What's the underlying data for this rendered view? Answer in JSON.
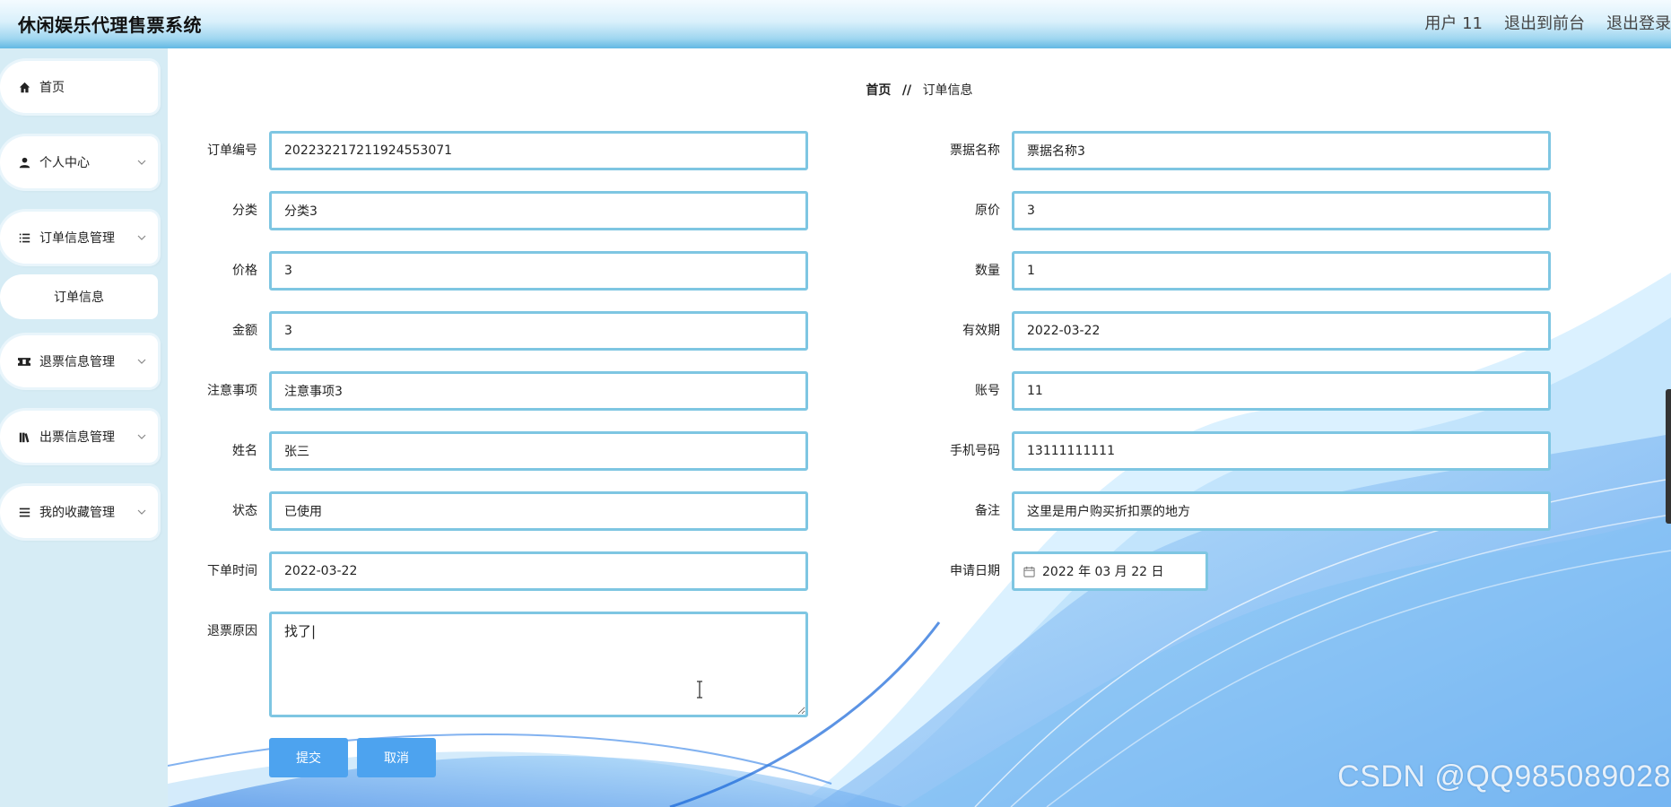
{
  "header": {
    "title": "休闲娱乐代理售票系统",
    "user": "用户 11",
    "to_front": "退出到前台",
    "logout": "退出登录"
  },
  "sidebar": {
    "items": [
      {
        "label": "首页",
        "icon": "home-icon"
      },
      {
        "label": "个人中心",
        "icon": "user-icon"
      },
      {
        "label": "订单信息管理",
        "icon": "list-icon"
      },
      {
        "label": "订单信息",
        "icon": ""
      },
      {
        "label": "退票信息管理",
        "icon": "ticket-icon"
      },
      {
        "label": "出票信息管理",
        "icon": "books-icon"
      },
      {
        "label": "我的收藏管理",
        "icon": "menu-icon"
      }
    ]
  },
  "breadcrumb": {
    "home": "首页",
    "separator": "//",
    "current": "订单信息"
  },
  "form": {
    "order_no": {
      "label": "订单编号",
      "value": "202232217211924553071"
    },
    "ticket_name": {
      "label": "票据名称",
      "value": "票据名称3"
    },
    "category": {
      "label": "分类",
      "value": "分类3"
    },
    "original_price": {
      "label": "原价",
      "value": "3"
    },
    "price": {
      "label": "价格",
      "value": "3"
    },
    "quantity": {
      "label": "数量",
      "value": "1"
    },
    "amount": {
      "label": "金额",
      "value": "3"
    },
    "valid_date": {
      "label": "有效期",
      "value": "2022-03-22"
    },
    "notes": {
      "label": "注意事项",
      "value": "注意事项3"
    },
    "account": {
      "label": "账号",
      "value": "11"
    },
    "name": {
      "label": "姓名",
      "value": "张三"
    },
    "phone": {
      "label": "手机号码",
      "value": "13111111111"
    },
    "status": {
      "label": "状态",
      "value": "已使用"
    },
    "remark": {
      "label": "备注",
      "value": "这里是用户购买折扣票的地方"
    },
    "order_time": {
      "label": "下单时间",
      "value": "2022-03-22"
    },
    "apply_date": {
      "label": "申请日期",
      "value": "2022 年 03 月 22 日"
    },
    "refund_reason": {
      "label": "退票原因",
      "value": "找了|"
    }
  },
  "buttons": {
    "submit": "提交",
    "cancel": "取消"
  },
  "watermark": "CSDN @QQ985089028",
  "colors": {
    "input_border": "#7ec6e2",
    "button": "#4da3ef",
    "sidebar_bg": "#d6ecf5"
  }
}
